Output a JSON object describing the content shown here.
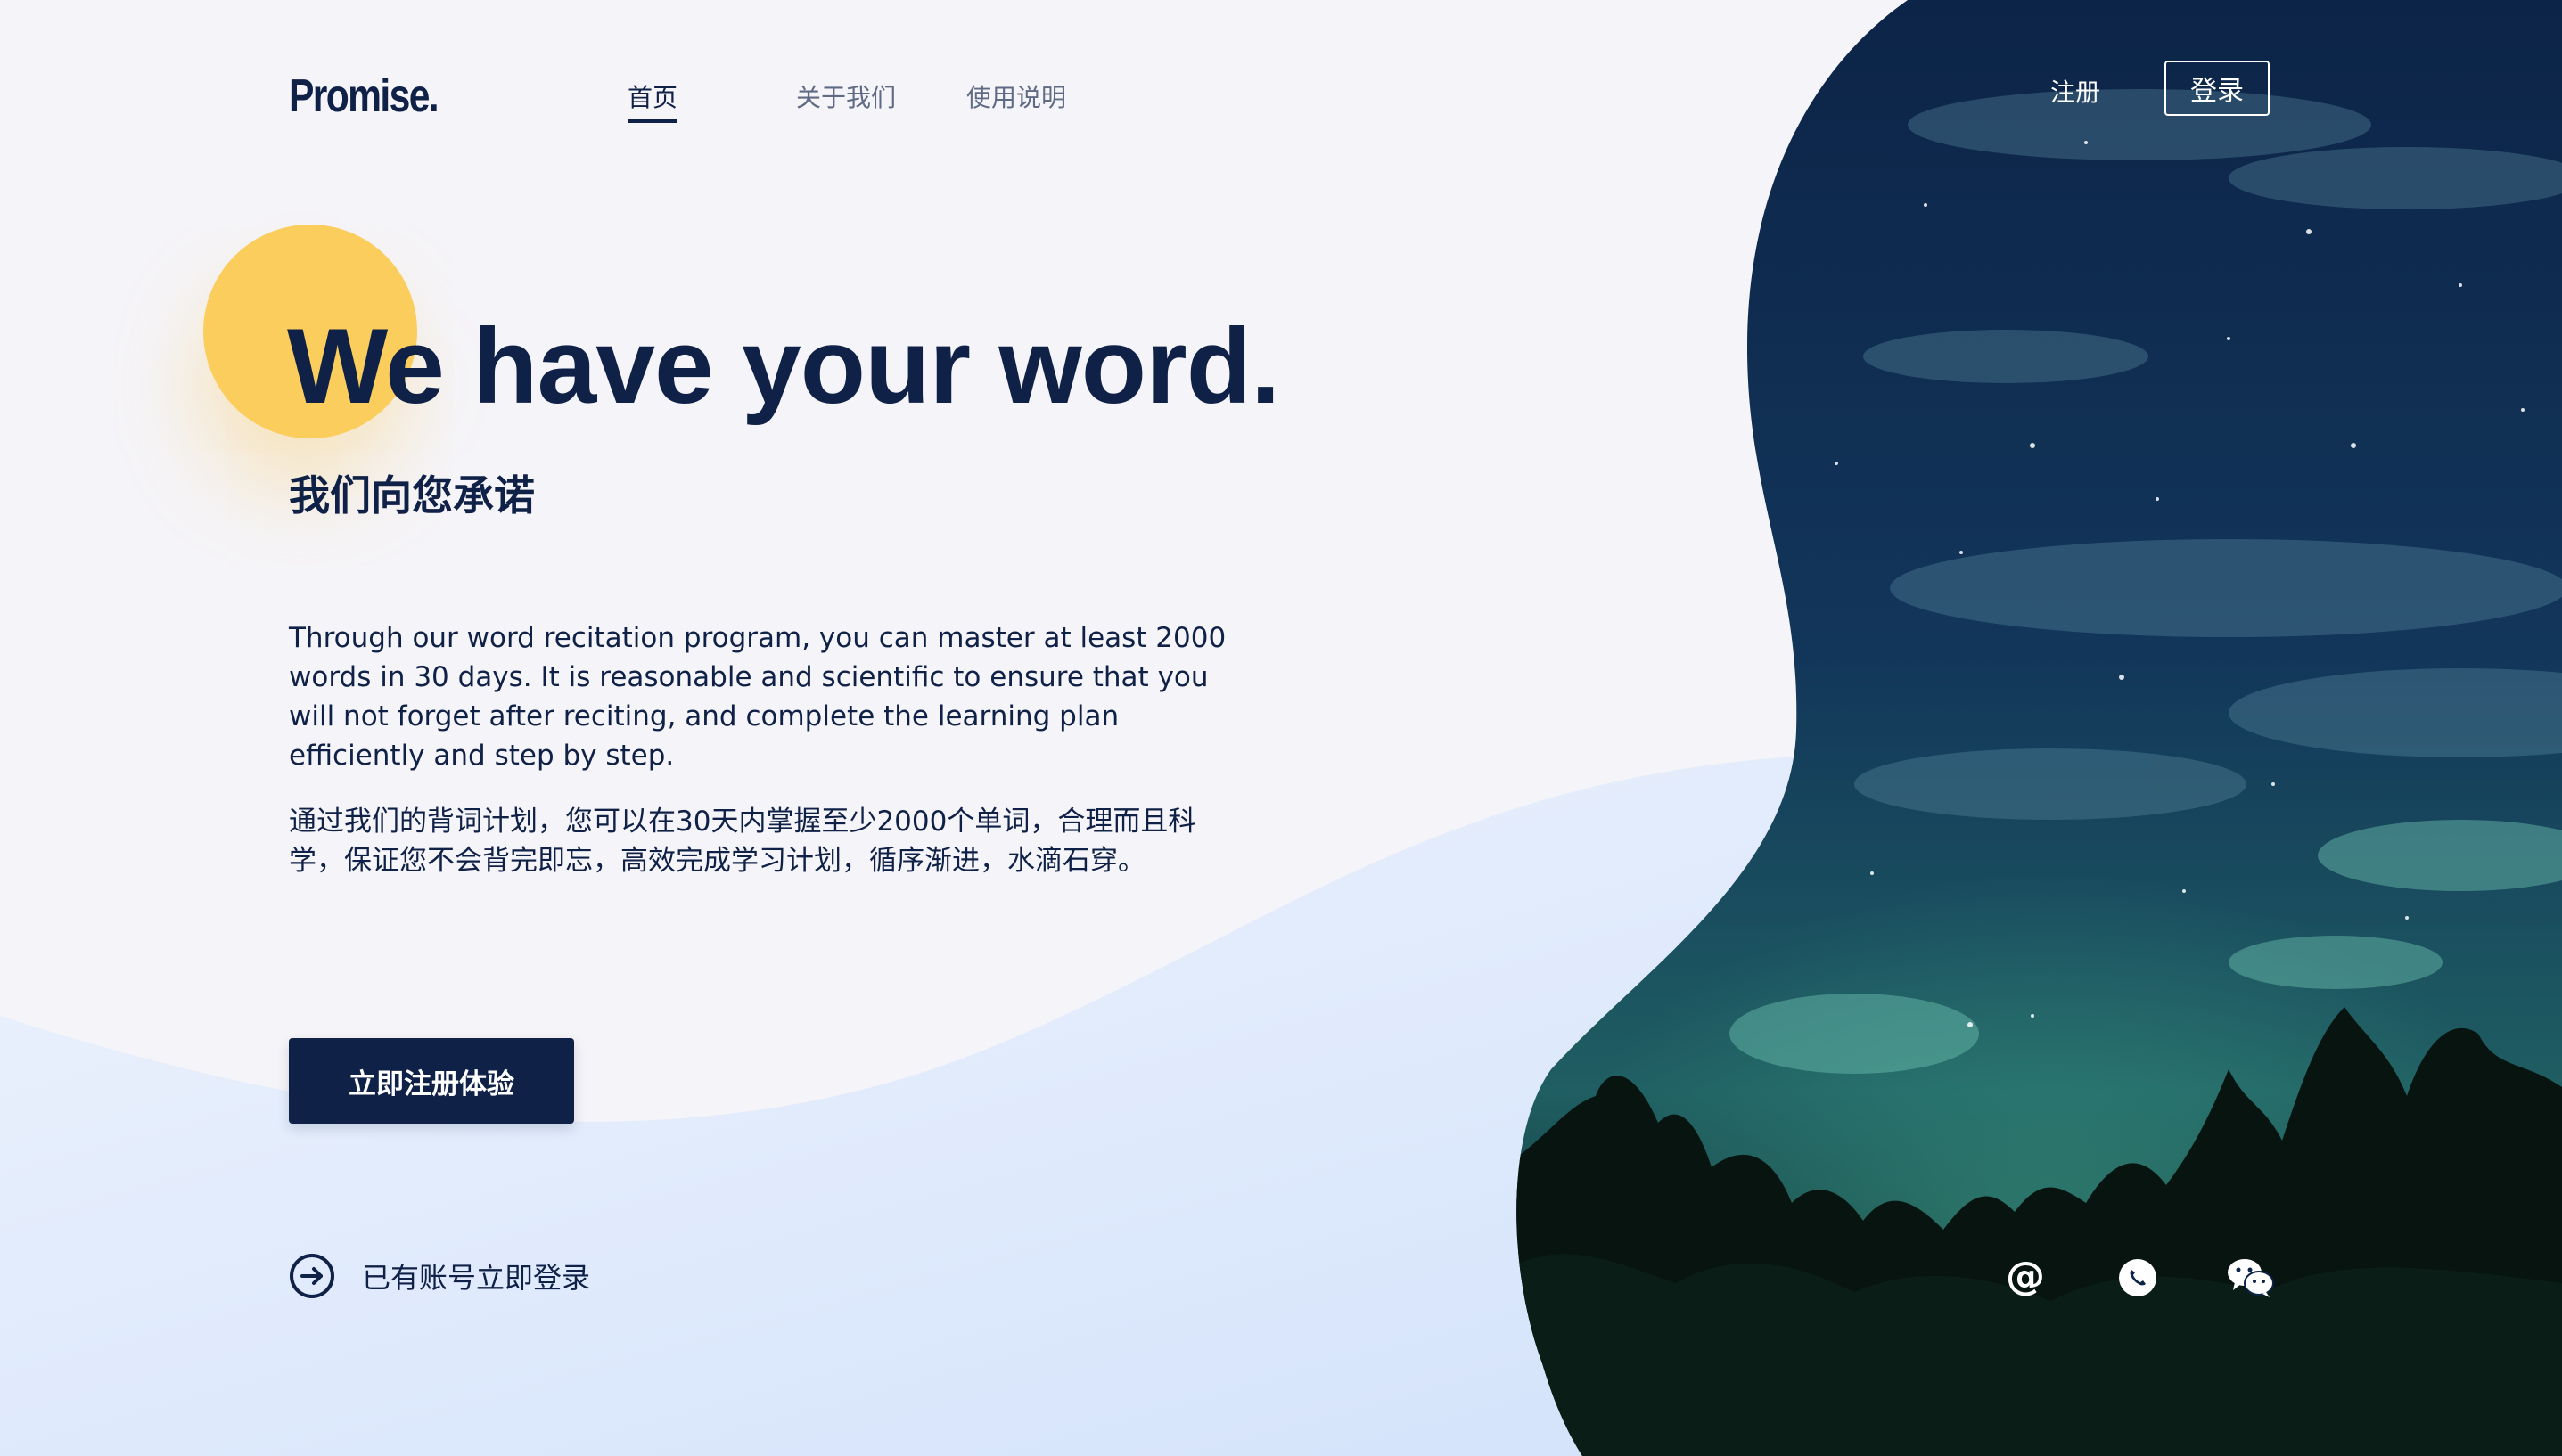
{
  "brand": {
    "logo": "Promise."
  },
  "nav": {
    "items": [
      {
        "label": "首页",
        "active": true
      },
      {
        "label": "关于我们",
        "active": false
      },
      {
        "label": "使用说明",
        "active": false
      }
    ]
  },
  "auth": {
    "register_label": "注册",
    "login_label": "登录"
  },
  "hero": {
    "headline": "We have your word.",
    "subheadline": "我们向您承诺",
    "description_en": "Through our word recitation program, you can master at least 2000 words in 30 days. It is reasonable and scientific to ensure that you will not forget after reciting, and complete the learning plan efficiently and step by step.",
    "description_zh": "通过我们的背词计划，您可以在30天内掌握至少2000个单词，合理而且科学，保证您不会背完即忘，高效完成学习计划，循序渐进，水滴石穿。",
    "cta_label": "立即注册体验",
    "login_link_label": "已有账号立即登录"
  },
  "social": [
    {
      "icon": "at-icon"
    },
    {
      "icon": "phone-icon"
    },
    {
      "icon": "wechat-icon"
    }
  ],
  "colors": {
    "navy": "#0f2147",
    "accent_yellow": "#fbcd5c",
    "background": "#f5f4f8",
    "light_blue": "#cfe0fb"
  }
}
